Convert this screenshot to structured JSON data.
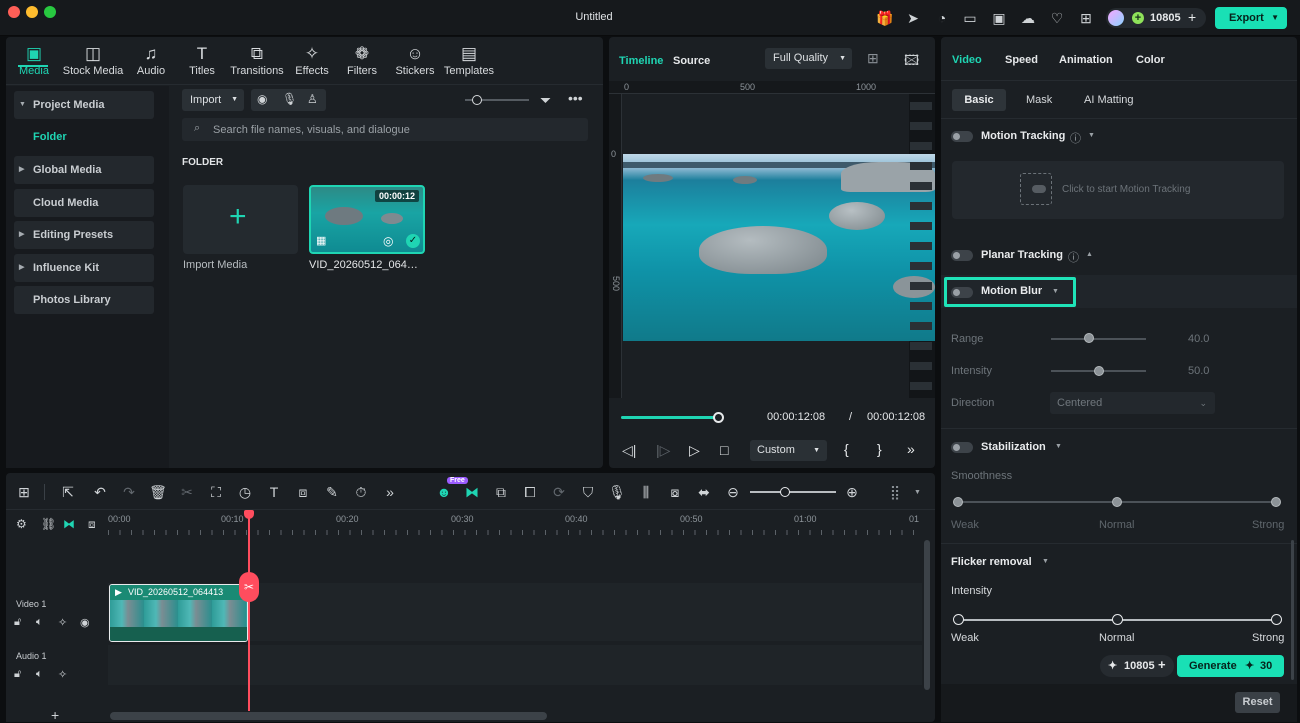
{
  "window": {
    "title": "Untitled"
  },
  "titlebar": {
    "credits": "10805",
    "export_label": "Export"
  },
  "media_tabs": [
    {
      "label": "Media",
      "icon": "media-icon"
    },
    {
      "label": "Stock Media",
      "icon": "stock-media-icon"
    },
    {
      "label": "Audio",
      "icon": "audio-icon"
    },
    {
      "label": "Titles",
      "icon": "titles-icon"
    },
    {
      "label": "Transitions",
      "icon": "transitions-icon"
    },
    {
      "label": "Effects",
      "icon": "effects-icon"
    },
    {
      "label": "Filters",
      "icon": "filters-icon"
    },
    {
      "label": "Stickers",
      "icon": "stickers-icon"
    },
    {
      "label": "Templates",
      "icon": "templates-icon"
    }
  ],
  "sidebar": {
    "items": [
      {
        "label": "Project Media",
        "caret": "▼"
      },
      {
        "label": "Folder"
      },
      {
        "label": "Global Media",
        "caret": "▶"
      },
      {
        "label": "Cloud Media"
      },
      {
        "label": "Editing Presets",
        "caret": "▶"
      },
      {
        "label": "Influence Kit",
        "caret": "▶"
      },
      {
        "label": "Photos Library"
      }
    ]
  },
  "library": {
    "import_label": "Import",
    "search_placeholder": "Search file names, visuals, and dialogue",
    "section_title": "FOLDER",
    "import_media_label": "Import Media",
    "clip": {
      "name": "VID_20260512_064…",
      "duration": "00:00:12"
    }
  },
  "preview": {
    "tab_timeline": "Timeline",
    "tab_source": "Source",
    "quality": "Full Quality",
    "ruler": [
      "0",
      "500",
      "1000"
    ],
    "current_time": "00:00:12:08",
    "separator": "/",
    "total_time": "00:00:12:08",
    "playback_progress": 1.0,
    "zoom_mode": "Custom"
  },
  "props": {
    "tabs": [
      "Video",
      "Speed",
      "Animation",
      "Color"
    ],
    "subtabs": [
      "Basic",
      "Mask",
      "AI Matting"
    ],
    "motion_tracking": {
      "label": "Motion Tracking",
      "hint": "Click to start Motion Tracking"
    },
    "planar_tracking": {
      "label": "Planar Tracking"
    },
    "motion_blur": {
      "label": "Motion Blur",
      "range_label": "Range",
      "range_value": "40.0",
      "range_fraction": 0.4,
      "intensity_label": "Intensity",
      "intensity_value": "50.0",
      "intensity_fraction": 0.5,
      "direction_label": "Direction",
      "direction_value": "Centered"
    },
    "stabilization": {
      "label": "Stabilization",
      "smoothness_label": "Smoothness",
      "levels": [
        "Weak",
        "Normal",
        "Strong"
      ]
    },
    "flicker": {
      "label": "Flicker removal",
      "intensity_label": "Intensity",
      "levels": [
        "Weak",
        "Normal",
        "Strong"
      ]
    },
    "generate": {
      "credits": "10805",
      "label": "Generate",
      "cost": "30"
    },
    "reset_label": "Reset"
  },
  "timeline": {
    "ruler_labels": [
      "00:00",
      "00:10",
      "00:20",
      "00:30",
      "00:40",
      "00:50",
      "01:00",
      "01"
    ],
    "tracks": {
      "video": "Video 1",
      "audio": "Audio 1"
    },
    "clip_name": "VID_20260512_064413",
    "ai_badge": "Free"
  },
  "colors": {
    "accent": "#1fd5b3",
    "playhead": "#ff4d5e",
    "export_bg": "#19e0b5"
  }
}
